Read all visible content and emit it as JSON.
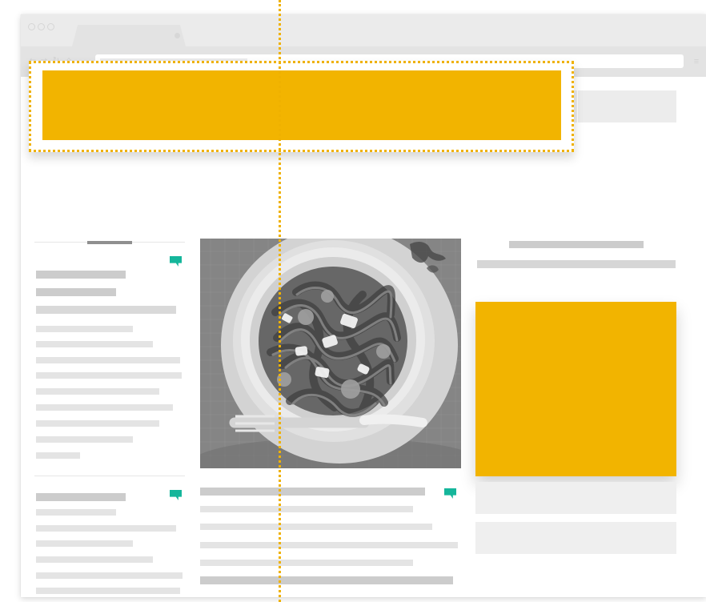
{
  "browser": {
    "window_controls": [
      "window-dot-icon",
      "window-dot-icon",
      "window-dot-icon"
    ],
    "tab_label": "",
    "address_value": "",
    "navigation_icons": [
      "back-arrow-icon",
      "forward-arrow-icon",
      "reload-icon",
      "home-icon"
    ],
    "menu_icon": "menu-icon"
  },
  "site": {
    "logo_icon": "plate-fork-knife-logo-icon",
    "nav_items": [
      "",
      "",
      "",
      "",
      ""
    ],
    "header_ad_label": "",
    "side_ad_label": "",
    "photo_subject": "pasta-bowl-photo"
  },
  "colors": {
    "ad_gold": "#f2b400",
    "guide_gold": "#efb100",
    "comment_teal": "#15b69b",
    "placeholder_gray": "#e4e4e4"
  }
}
